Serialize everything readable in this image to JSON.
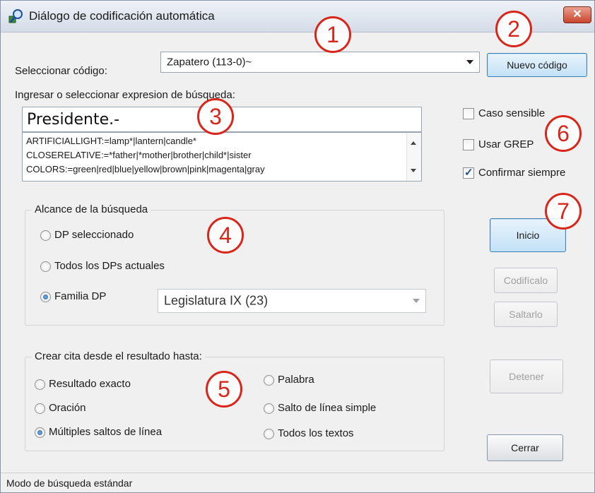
{
  "window": {
    "title": "Diálogo de codificación automática",
    "close_label": "✕"
  },
  "code": {
    "label": "Seleccionar código:",
    "selected": "Zapatero (113-0)~",
    "new_button": "Nuevo código"
  },
  "search": {
    "label": "Ingresar o seleccionar expresion de búsqueda:",
    "value": "Presidente.-",
    "list": [
      "ARTIFICIALLIGHT:=lamp*|lantern|candle*",
      "CLOSERELATIVE:=*father|*mother|brother|child*|sister",
      "COLORS:=green|red|blue|yellow|brown|pink|magenta|gray"
    ]
  },
  "options": {
    "case_sensitive": {
      "label": "Caso sensible",
      "checked": false
    },
    "use_grep": {
      "label": "Usar GREP",
      "checked": false
    },
    "always_confirm": {
      "label": "Confirmar siempre",
      "checked": true
    }
  },
  "scope": {
    "title": "Alcance de la búsqueda",
    "options": [
      "DP seleccionado",
      "Todos los DPs actuales",
      "Familia DP"
    ],
    "selected_index": 2,
    "family_value": "Legislatura IX (23)"
  },
  "quote": {
    "title": "Crear cita desde el resultado hasta:",
    "left_options": [
      "Resultado exacto",
      "Oración",
      "Múltiples saltos de línea"
    ],
    "right_options": [
      "Palabra",
      "Salto de línea simple",
      "Todos los textos"
    ],
    "selected": "Múltiples saltos de línea"
  },
  "buttons": {
    "start": "Inicio",
    "code_it": "Codifícalo",
    "skip": "Saltarlo",
    "stop": "Detener",
    "close": "Cerrar"
  },
  "markers": [
    "1",
    "2",
    "3",
    "4",
    "5",
    "6",
    "7"
  ],
  "status": {
    "text": "Modo de búsqueda estándar"
  },
  "colors": {
    "marker": "#d8261b",
    "focus_button": "#c3e1f7",
    "titlebar": "#d4dce8",
    "close": "#c9452c"
  }
}
